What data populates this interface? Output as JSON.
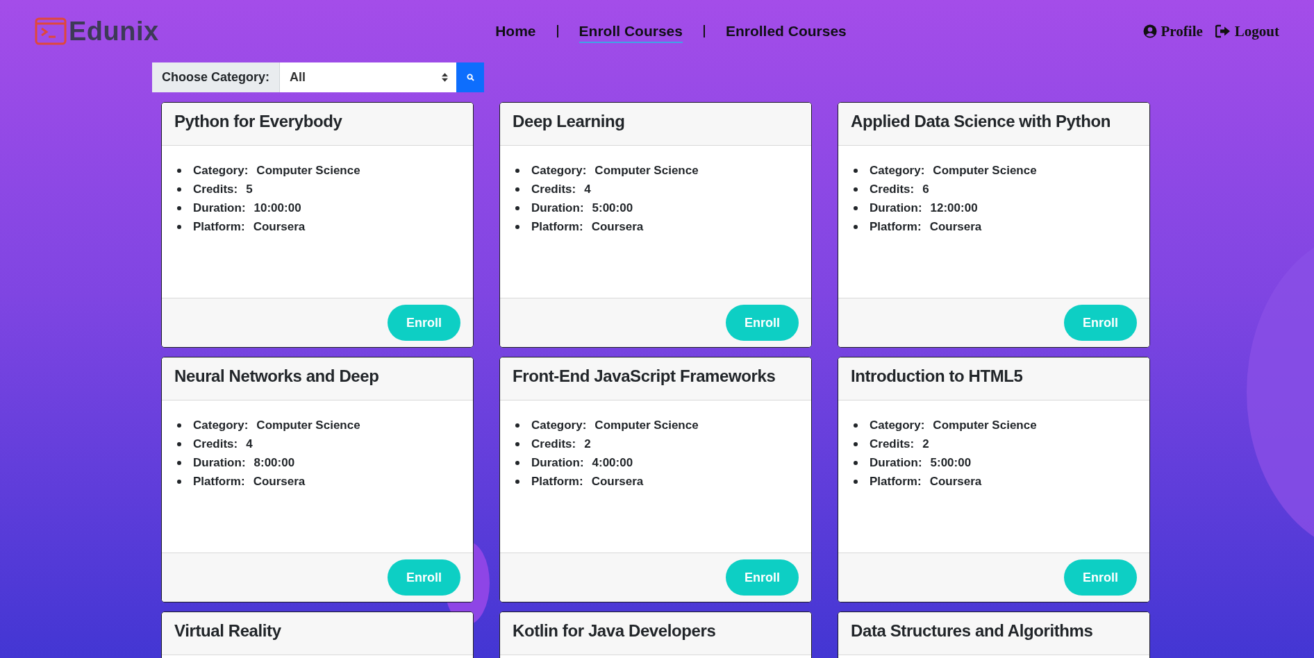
{
  "brand": {
    "name": "Edunix"
  },
  "nav": [
    {
      "label": "Home",
      "selected": false
    },
    {
      "label": "Enroll Courses",
      "selected": true
    },
    {
      "label": "Enrolled Courses",
      "selected": false
    }
  ],
  "account": [
    {
      "kind": "profile",
      "label": "Profile"
    },
    {
      "kind": "logout",
      "label": "Logout"
    }
  ],
  "filter": {
    "label": "Choose Category:",
    "value": "All"
  },
  "courses": [
    {
      "title": "Python for Everybody",
      "details": [
        {
          "label": "Category:",
          "value": "Computer Science"
        },
        {
          "label": "Credits:",
          "value": "5"
        },
        {
          "label": "Duration:",
          "value": "10:00:00"
        },
        {
          "label": "Platform:",
          "value": "Coursera"
        }
      ],
      "button": "Enroll"
    },
    {
      "title": "Deep Learning",
      "details": [
        {
          "label": "Category:",
          "value": "Computer Science"
        },
        {
          "label": "Credits:",
          "value": "4"
        },
        {
          "label": "Duration:",
          "value": "5:00:00"
        },
        {
          "label": "Platform:",
          "value": "Coursera"
        }
      ],
      "button": "Enroll"
    },
    {
      "title": "Applied Data Science with Python",
      "details": [
        {
          "label": "Category:",
          "value": "Computer Science"
        },
        {
          "label": "Credits:",
          "value": "6"
        },
        {
          "label": "Duration:",
          "value": "12:00:00"
        },
        {
          "label": "Platform:",
          "value": "Coursera"
        }
      ],
      "button": "Enroll"
    },
    {
      "title": "Neural Networks and Deep",
      "details": [
        {
          "label": "Category:",
          "value": "Computer Science"
        },
        {
          "label": "Credits:",
          "value": "4"
        },
        {
          "label": "Duration:",
          "value": "8:00:00"
        },
        {
          "label": "Platform:",
          "value": "Coursera"
        }
      ],
      "button": "Enroll"
    },
    {
      "title": "Front-End JavaScript Frameworks",
      "details": [
        {
          "label": "Category:",
          "value": "Computer Science"
        },
        {
          "label": "Credits:",
          "value": "2"
        },
        {
          "label": "Duration:",
          "value": "4:00:00"
        },
        {
          "label": "Platform:",
          "value": "Coursera"
        }
      ],
      "button": "Enroll"
    },
    {
      "title": "Introduction to HTML5",
      "details": [
        {
          "label": "Category:",
          "value": "Computer Science"
        },
        {
          "label": "Credits:",
          "value": "2"
        },
        {
          "label": "Duration:",
          "value": "5:00:00"
        },
        {
          "label": "Platform:",
          "value": "Coursera"
        }
      ],
      "button": "Enroll"
    },
    {
      "title": "Virtual Reality"
    },
    {
      "title": "Kotlin for Java Developers"
    },
    {
      "title": "Data Structures and Algorithms"
    }
  ]
}
